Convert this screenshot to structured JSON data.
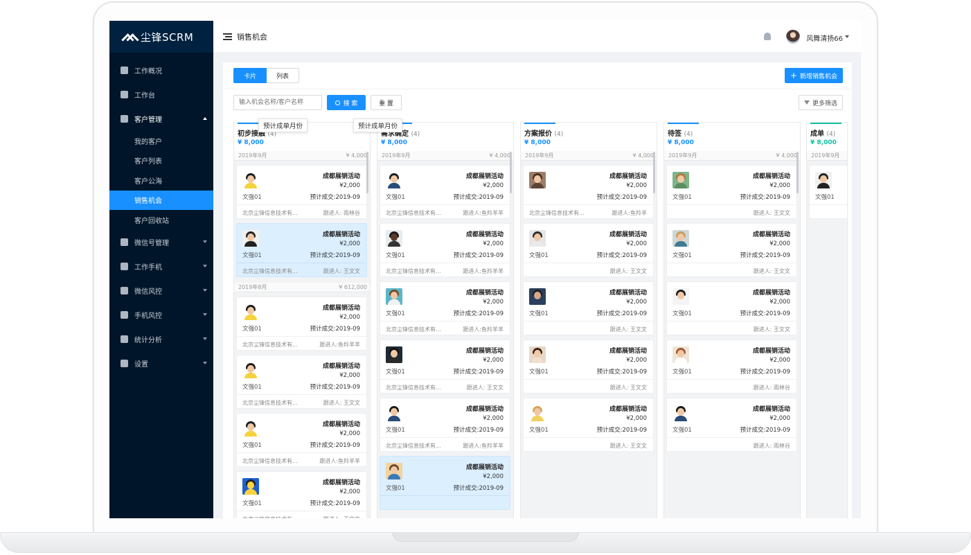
{
  "logo": {
    "text": "尘锋SCRM"
  },
  "menu": [
    {
      "label": "工作概况",
      "icon": "monitor-icon"
    },
    {
      "label": "工作台",
      "icon": "workbench-icon"
    },
    {
      "label": "客户管理",
      "icon": "users-icon",
      "open": true,
      "children": [
        "我的客户",
        "客户列表",
        "客户公海",
        "销售机会",
        "客户回收站"
      ],
      "active_child": 3
    },
    {
      "label": "微信号管理",
      "icon": "wechat-icon"
    },
    {
      "label": "工作手机",
      "icon": "phone-icon"
    },
    {
      "label": "微信风控",
      "icon": "shield-icon"
    },
    {
      "label": "手机风控",
      "icon": "phone-shield-icon"
    },
    {
      "label": "统计分析",
      "icon": "pie-chart-icon"
    },
    {
      "label": "设置",
      "icon": "gear-icon"
    }
  ],
  "topbar": {
    "title": "销售机会",
    "user": "风舞清扬66"
  },
  "toolbar": {
    "tab_card": "卡片",
    "tab_list": "列表",
    "add": "新增销售机会"
  },
  "search": {
    "placeholder": "输入机会名称/客户名称",
    "search": "搜 索",
    "reset": "重 置",
    "filter": "更多筛选"
  },
  "tooltips": [
    "预计成单月份",
    "预计成单月份"
  ],
  "colors": {
    "primary": "#1890ff",
    "sidebar": "#001529",
    "success": "#13c2a3"
  },
  "columns": [
    {
      "title": "初步接触",
      "count": "(4)",
      "amount": "¥ 8,000",
      "bar": "#1890ff",
      "groups": [
        {
          "month": "2019年9月",
          "total": "¥ 4,000",
          "cards": [
            {
              "name": "成都展销活动",
              "value": "¥2,000",
              "owner": "文强01",
              "date": "预计成交:2019-09",
              "company": "北京尘锋信息技术有...",
              "follower": "跟进人: 雨林谷",
              "avatar": "v1",
              "hl": false
            },
            {
              "name": "成都展销活动",
              "value": "¥2,000",
              "owner": "文强01",
              "date": "预计成交:2019-09",
              "company": "北京尘锋信息技术有...",
              "follower": "跟进人: 王文文",
              "avatar": "v2",
              "hl": true
            }
          ]
        },
        {
          "month": "2019年8月",
          "total": "¥ 612,000",
          "cards": [
            {
              "name": "成都展销活动",
              "value": "¥2,000",
              "owner": "文强01",
              "date": "预计成交:2019-09",
              "company": "北京尘锋信息技术有...",
              "follower": "跟进人:鱼羚羊羊",
              "avatar": "v1",
              "hl": false
            },
            {
              "name": "成都展销活动",
              "value": "¥2,000",
              "owner": "文强01",
              "date": "预计成交:2019-09",
              "company": "北京尘锋信息技术有...",
              "follower": "跟进人: 王文文",
              "avatar": "v1",
              "hl": false
            },
            {
              "name": "成都展销活动",
              "value": "¥2,000",
              "owner": "文强01",
              "date": "预计成交:2019-09",
              "company": "北京尘锋信息技术有...",
              "follower": "跟进人:鱼羚羊羊",
              "avatar": "v1",
              "hl": false
            },
            {
              "name": "成都展销活动",
              "value": "¥2,000",
              "owner": "文强01",
              "date": "预计成交:2019-09",
              "company": "北京尘锋信息技术有...",
              "follower": "跟进人: 王文文",
              "avatar": "v7",
              "hl": false
            }
          ]
        }
      ]
    },
    {
      "title": "需求确定",
      "count": "(4)",
      "amount": "¥ 8,000",
      "bar": "#1890ff",
      "groups": [
        {
          "month": "2019年9月",
          "total": "¥ 4,000",
          "cards": [
            {
              "name": "成都展销活动",
              "value": "¥2,000",
              "owner": "文强01",
              "date": "预计成交:2019-09",
              "company": "北京尘锋信息技术有...",
              "follower": "跟进人:鱼羚羊羊",
              "avatar": "v17",
              "hl": false
            },
            {
              "name": "成都展销活动",
              "value": "¥2,000",
              "owner": "文强01",
              "date": "预计成交:2019-09",
              "company": "北京尘锋信息技术有...",
              "follower": "跟进人:鱼羚羊羊",
              "avatar": "v3",
              "hl": false
            },
            {
              "name": "成都展销活动",
              "value": "¥2,000",
              "owner": "文强01",
              "date": "预计成交:2019-09",
              "company": "北京尘锋信息技术有...",
              "follower": "跟进人:鱼羚羊羊",
              "avatar": "v4",
              "hl": false
            },
            {
              "name": "成都展销活动",
              "value": "¥2,000",
              "owner": "文强01",
              "date": "预计成交:2019-09",
              "company": "北京尘锋信息技术有...",
              "follower": "跟进人: 王文文",
              "avatar": "v5",
              "hl": false
            },
            {
              "name": "成都展销活动",
              "value": "¥2,000",
              "owner": "文强01",
              "date": "预计成交:2019-09",
              "company": "北京尘锋信息技术有...",
              "follower": "跟进人:鱼羚羊羊",
              "avatar": "v17",
              "hl": false
            },
            {
              "name": "成都展销活动",
              "value": "¥2,000",
              "owner": "文强01",
              "date": "预计成交:2019-09",
              "company": "",
              "follower": "",
              "avatar": "v6",
              "hl": true
            }
          ]
        }
      ]
    },
    {
      "title": "方案报价",
      "count": "(4)",
      "amount": "¥ 8,000",
      "bar": "#1890ff",
      "groups": [
        {
          "month": "2019年9月",
          "total": "¥ 4,000",
          "cards": [
            {
              "name": "成都展销活动",
              "value": "¥2,000",
              "owner": "",
              "date": "预计成交:2019-09",
              "company": "北京尘锋信息技术有...",
              "follower": "跟进人:鱼羚羊",
              "avatar": "v8",
              "hl": false
            },
            {
              "name": "成都展销活动",
              "value": "¥2,000",
              "owner": "文强01",
              "date": "预计成交:2019-09",
              "company": "",
              "follower": "跟进人: 王文文",
              "avatar": "v9",
              "hl": false
            },
            {
              "name": "成都展销活动",
              "value": "¥2,000",
              "owner": "文强01",
              "date": "预计成交:2019-09",
              "company": "",
              "follower": "跟进人: 王文文",
              "avatar": "v10",
              "hl": false
            },
            {
              "name": "成都展销活动",
              "value": "¥2,000",
              "owner": "文强01",
              "date": "预计成交:2019-09",
              "company": "",
              "follower": "跟进人: 王文文",
              "avatar": "v11",
              "hl": false
            },
            {
              "name": "成都展销活动",
              "value": "¥2,000",
              "owner": "文强01",
              "date": "预计成交:2019-09",
              "company": "",
              "follower": "跟进人: 王文文",
              "avatar": "v12",
              "hl": false
            }
          ]
        }
      ]
    },
    {
      "title": "待签",
      "count": "(4)",
      "amount": "¥ 8,000",
      "bar": "#1890ff",
      "groups": [
        {
          "month": "2019年9月",
          "total": "¥ 4,000",
          "cards": [
            {
              "name": "成都展销活动",
              "value": "¥2,000",
              "owner": "文强01",
              "date": "预计成交:2019-09",
              "company": "",
              "follower": "跟进人: 王文文",
              "avatar": "v13",
              "hl": false
            },
            {
              "name": "成都展销活动",
              "value": "¥2,000",
              "owner": "文强01",
              "date": "预计成交:2019-09",
              "company": "",
              "follower": "跟进人: 王文文",
              "avatar": "v14",
              "hl": false
            },
            {
              "name": "成都展销活动",
              "value": "¥2,000",
              "owner": "文强01",
              "date": "预计成交:2019-09",
              "company": "",
              "follower": "跟进人: 王文文",
              "avatar": "v15",
              "hl": false
            },
            {
              "name": "成都展销活动",
              "value": "¥2,000",
              "owner": "文强01",
              "date": "预计成交:2019-09",
              "company": "",
              "follower": "跟进人: 雨林谷",
              "avatar": "v16",
              "hl": false
            },
            {
              "name": "成都展销活动",
              "value": "¥2,000",
              "owner": "文强01",
              "date": "预计成交:2019-09",
              "company": "",
              "follower": "跟进人: 雨林谷",
              "avatar": "v17",
              "hl": false
            }
          ]
        }
      ]
    },
    {
      "title": "成单",
      "count": "(4)",
      "amount": "¥ 8,000",
      "bar": "#13c2a3",
      "groups": [
        {
          "month": "2019年9月",
          "total": "",
          "cards": [
            {
              "name": "",
              "value": "",
              "owner": "文强01",
              "date": "",
              "company": "",
              "follower": "",
              "avatar": "v2",
              "hl": false
            }
          ]
        }
      ]
    }
  ]
}
